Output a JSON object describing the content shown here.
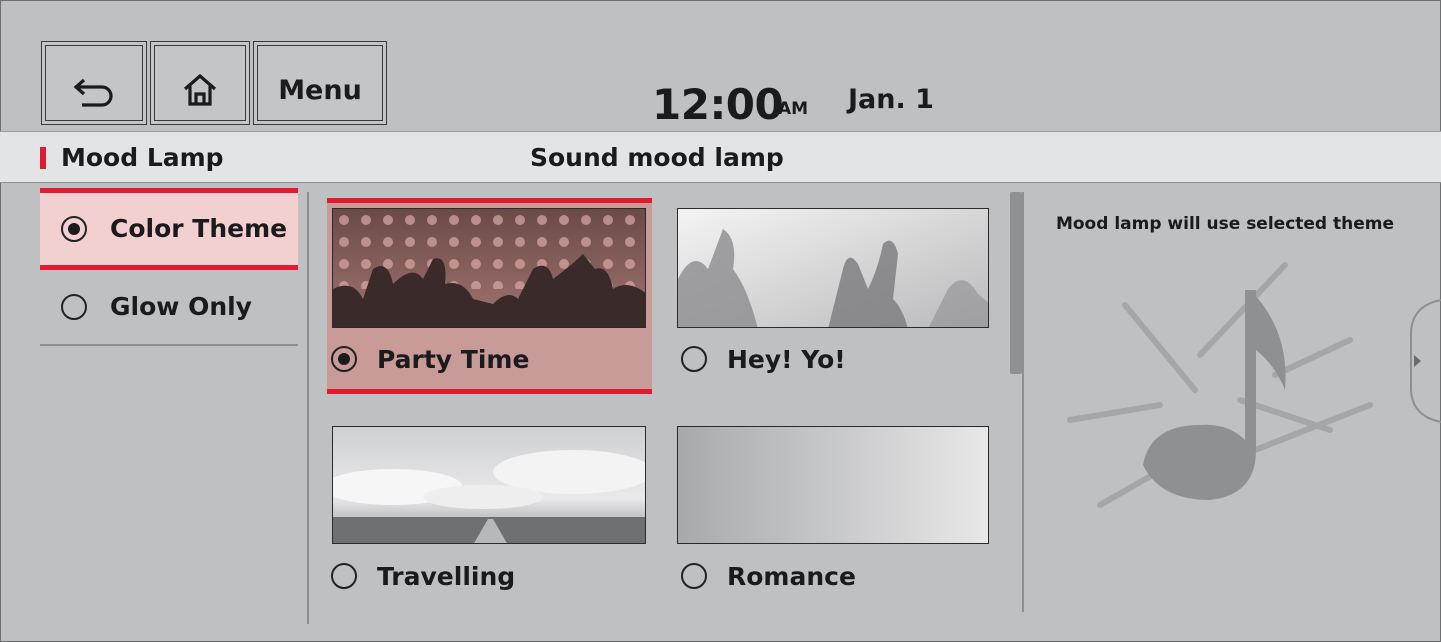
{
  "header": {
    "back_icon": "back-arrow-icon",
    "home_icon": "home-icon",
    "menu_label": "Menu",
    "time": "12:00",
    "ampm": "AM",
    "date": "Jan. 1"
  },
  "titlebar": {
    "left_title": "Mood Lamp",
    "center_title": "Sound mood lamp",
    "accent_color": "#e01a2f"
  },
  "left_options": [
    {
      "label": "Color Theme",
      "selected": true
    },
    {
      "label": "Glow Only",
      "selected": false
    }
  ],
  "themes": [
    {
      "label": "Party Time",
      "selected": true
    },
    {
      "label": "Hey! Yo!",
      "selected": false
    },
    {
      "label": "Travelling",
      "selected": false
    },
    {
      "label": "Romance",
      "selected": false
    }
  ],
  "preview": {
    "description": "Mood lamp will use selected theme",
    "icon": "music-note-icon",
    "handle_icon": "chevron-left-icon"
  }
}
